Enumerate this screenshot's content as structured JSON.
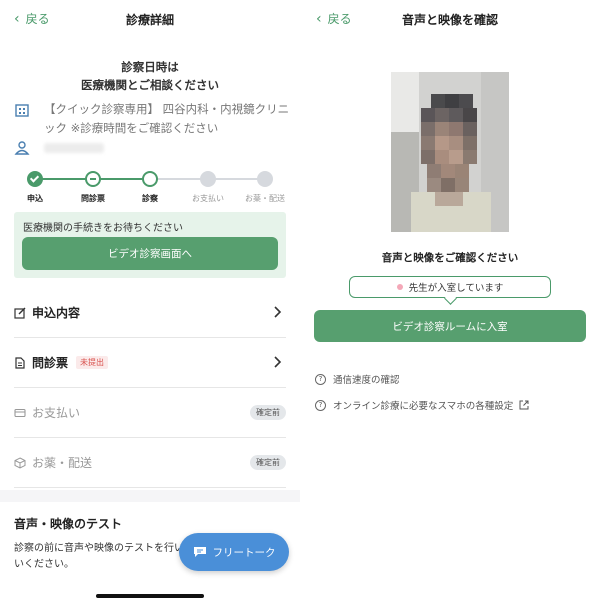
{
  "left": {
    "back_label": "戻る",
    "title": "診療詳細",
    "notice_line1": "診察日時は",
    "notice_line2": "医療機関とご相談ください",
    "clinic_text": "【クイック診察専用】 四谷内科・内視鏡クリニック ※診療時間をご確認ください",
    "steps": [
      {
        "label": "申込",
        "state": "done"
      },
      {
        "label": "問診票",
        "state": "partial"
      },
      {
        "label": "診察",
        "state": "current"
      },
      {
        "label": "お支払い",
        "state": "todo"
      },
      {
        "label": "お薬・配送",
        "state": "todo"
      }
    ],
    "wait_text": "医療機関の手続きをお待ちください",
    "video_button": "ビデオ診察画面へ",
    "menu": {
      "application": "申込内容",
      "questionnaire": "問診票",
      "questionnaire_badge": "未提出",
      "payment": "お支払い",
      "payment_badge": "確定前",
      "delivery": "お薬・配送",
      "delivery_badge": "確定前"
    },
    "av_test_title": "音声・映像のテスト",
    "av_test_desc": "診察の前に音声や映像のテストを行い　　　　 いください。",
    "free_talk": "フリートーク"
  },
  "right": {
    "back_label": "戻る",
    "title": "音声と映像を確認",
    "confirm_text": "音声と映像をご確認ください",
    "doctor_status": "先生が入室しています",
    "enter_button": "ビデオ診察ルームに入室",
    "help_speed": "通信速度の確認",
    "help_settings": "オンライン診療に必要なスマホの各種設定"
  },
  "colors": {
    "accent_green": "#579f6f",
    "free_talk_blue": "#4a8fd8",
    "warning_red": "#d9534f"
  }
}
